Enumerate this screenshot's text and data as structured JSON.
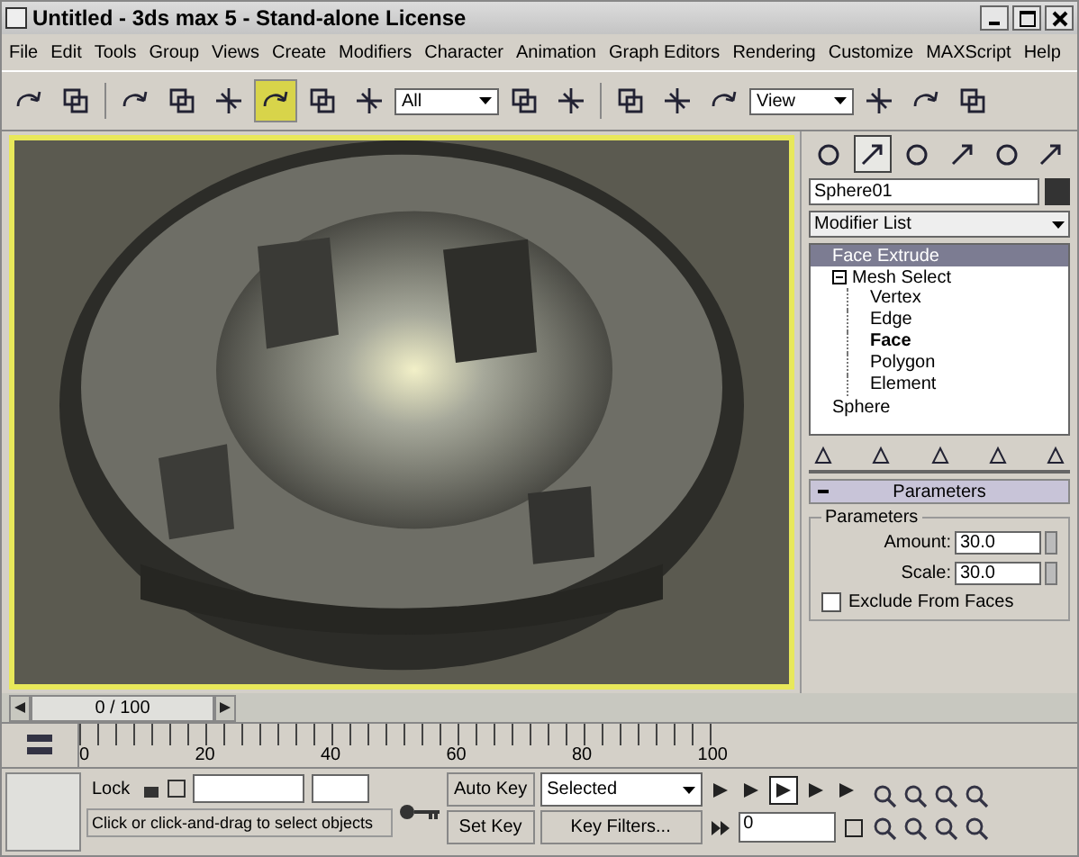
{
  "window": {
    "title": "Untitled - 3ds max 5 - Stand-alone License"
  },
  "menu": [
    "File",
    "Edit",
    "Tools",
    "Group",
    "Views",
    "Create",
    "Modifiers",
    "Character",
    "Animation",
    "Graph Editors",
    "Rendering",
    "Customize",
    "MAXScript",
    "Help"
  ],
  "toolbar": [
    {
      "kind": "icon",
      "selected": false
    },
    {
      "kind": "icon",
      "selected": false
    },
    {
      "kind": "sep"
    },
    {
      "kind": "icon",
      "selected": false
    },
    {
      "kind": "icon",
      "selected": false
    },
    {
      "kind": "icon",
      "selected": false
    },
    {
      "kind": "icon",
      "selected": true
    },
    {
      "kind": "icon",
      "selected": false
    },
    {
      "kind": "icon",
      "selected": false
    },
    {
      "kind": "dropdown",
      "value": "All"
    },
    {
      "kind": "icon",
      "selected": false
    },
    {
      "kind": "icon",
      "selected": false
    },
    {
      "kind": "sep"
    },
    {
      "kind": "icon",
      "selected": false
    },
    {
      "kind": "icon",
      "selected": false
    },
    {
      "kind": "icon",
      "selected": false
    },
    {
      "kind": "dropdown",
      "value": "View"
    },
    {
      "kind": "icon",
      "selected": false
    },
    {
      "kind": "icon",
      "selected": false
    },
    {
      "kind": "icon",
      "selected": false
    }
  ],
  "command_panel": {
    "tabs": [
      {
        "selected": false
      },
      {
        "selected": true
      },
      {
        "selected": false
      },
      {
        "selected": false
      },
      {
        "selected": false
      },
      {
        "selected": false
      }
    ],
    "object_name": "Sphere01",
    "modifier_list": "Modifier List",
    "stack": [
      {
        "label": "Face Extrude",
        "selected": true,
        "expanded": false
      },
      {
        "label": "Mesh Select",
        "selected": false,
        "expanded": true,
        "children": [
          {
            "label": "Vertex",
            "selected": false
          },
          {
            "label": "Edge",
            "selected": false
          },
          {
            "label": "Face",
            "selected": true
          },
          {
            "label": "Polygon",
            "selected": false
          },
          {
            "label": "Element",
            "selected": false
          }
        ]
      },
      {
        "label": "Sphere",
        "selected": false,
        "expanded": false
      }
    ],
    "rollout": {
      "title": "Parameters",
      "group": "Parameters",
      "fields": [
        {
          "label": "Amount:",
          "value": "30.0"
        },
        {
          "label": "Scale:",
          "value": "30.0"
        }
      ],
      "checkbox": {
        "label": "Exclude From Faces",
        "checked": false
      }
    }
  },
  "timeline": {
    "frame": "0 / 100",
    "ticks": [
      "0",
      "20",
      "40",
      "60",
      "80",
      "100"
    ]
  },
  "bottom": {
    "lock": "Lock",
    "auto_key": "Auto Key",
    "key_mode": "Selected",
    "set_key": "Set Key",
    "key_filters": "Key Filters...",
    "current_frame": "0",
    "status": "Click or click-and-drag to select objects"
  }
}
